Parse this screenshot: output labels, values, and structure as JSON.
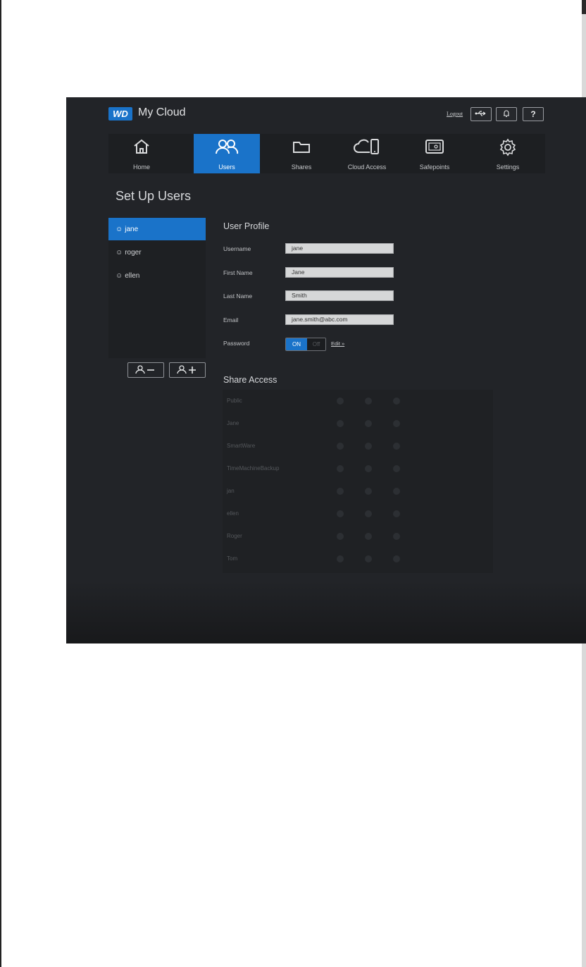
{
  "app": {
    "logo_text": "WD",
    "title": "My Cloud"
  },
  "header": {
    "logout_label": "Logout",
    "usb_icon": "usb-icon",
    "alert_icon": "bell-icon",
    "help_label": "?"
  },
  "nav": {
    "items": [
      {
        "label": "Home",
        "icon": "home-icon",
        "active": false
      },
      {
        "label": "Users",
        "icon": "users-icon",
        "active": true
      },
      {
        "label": "Shares",
        "icon": "folder-icon",
        "active": false
      },
      {
        "label": "Cloud Access",
        "icon": "cloud-device-icon",
        "active": false
      },
      {
        "label": "Safepoints",
        "icon": "safe-icon",
        "active": false
      },
      {
        "label": "Settings",
        "icon": "gear-icon",
        "active": false
      }
    ]
  },
  "page": {
    "heading": "Set Up Users"
  },
  "users": {
    "items": [
      {
        "name": "jane",
        "active": true
      },
      {
        "name": "roger",
        "active": false
      },
      {
        "name": "ellen",
        "active": false
      }
    ],
    "remove_button_icon": "remove-user-icon",
    "add_button_icon": "add-user-icon"
  },
  "profile": {
    "title": "User Profile",
    "username_label": "Username",
    "username_value": "jane",
    "first_name_label": "First Name",
    "first_name_value": "Jane",
    "last_name_label": "Last Name",
    "last_name_value": "Smith",
    "email_label": "Email",
    "email_value": "jane.smith@abc.com",
    "password_label": "Password",
    "toggle_on": "ON",
    "toggle_off": "Off",
    "edit_label": "Edit »"
  },
  "share_access": {
    "title": "Share Access",
    "rows": [
      "Public",
      "Jane",
      "SmartWare",
      "TimeMachineBackup",
      "jan",
      "ellen",
      "Roger",
      "Tom"
    ]
  },
  "colors": {
    "accent": "#1a73c9",
    "background": "#222428"
  }
}
